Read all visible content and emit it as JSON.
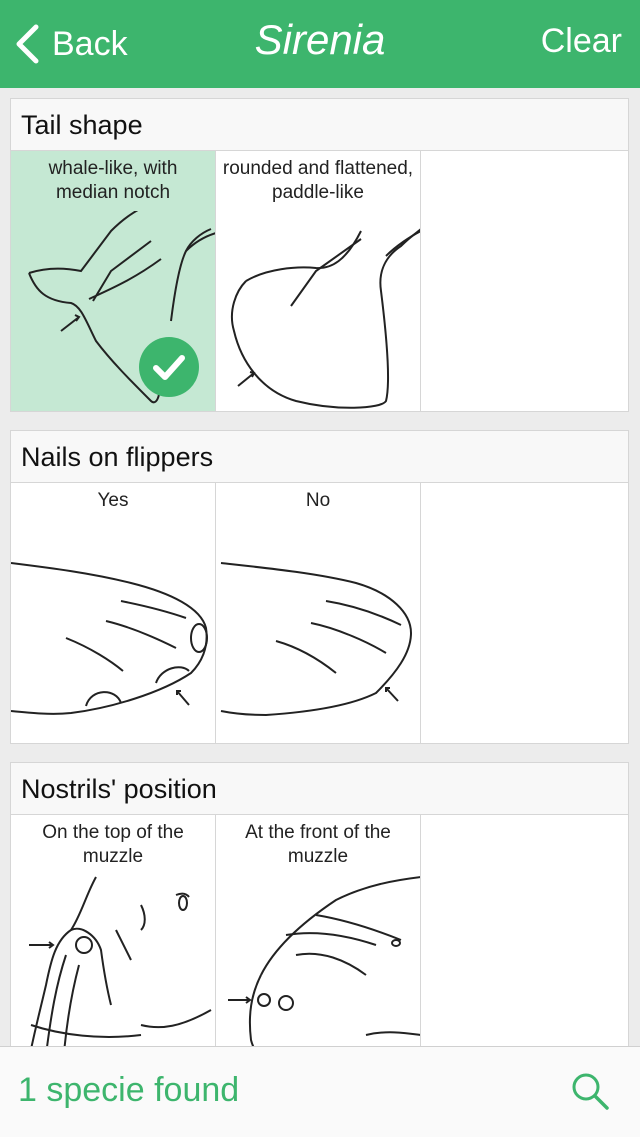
{
  "nav": {
    "back_label": "Back",
    "title": "Sirenia",
    "clear_label": "Clear"
  },
  "sections": [
    {
      "title": "Tail shape",
      "options": [
        {
          "label": "whale-like, with median notch",
          "selected": true
        },
        {
          "label": "rounded and flattened, paddle-like",
          "selected": false
        }
      ]
    },
    {
      "title": "Nails on flippers",
      "options": [
        {
          "label": "Yes",
          "selected": false
        },
        {
          "label": "No",
          "selected": false
        }
      ]
    },
    {
      "title": "Nostrils' position",
      "options": [
        {
          "label": "On the top of the muzzle",
          "selected": false
        },
        {
          "label": "At the front of the muzzle",
          "selected": false
        }
      ]
    }
  ],
  "footer": {
    "found_text": "1 specie found"
  },
  "icons": {
    "back": "chevron-left-icon",
    "selected": "checkmark-icon",
    "search": "search-icon"
  },
  "colors": {
    "accent": "#3db56d",
    "selected_bg": "#c5e8d3"
  }
}
